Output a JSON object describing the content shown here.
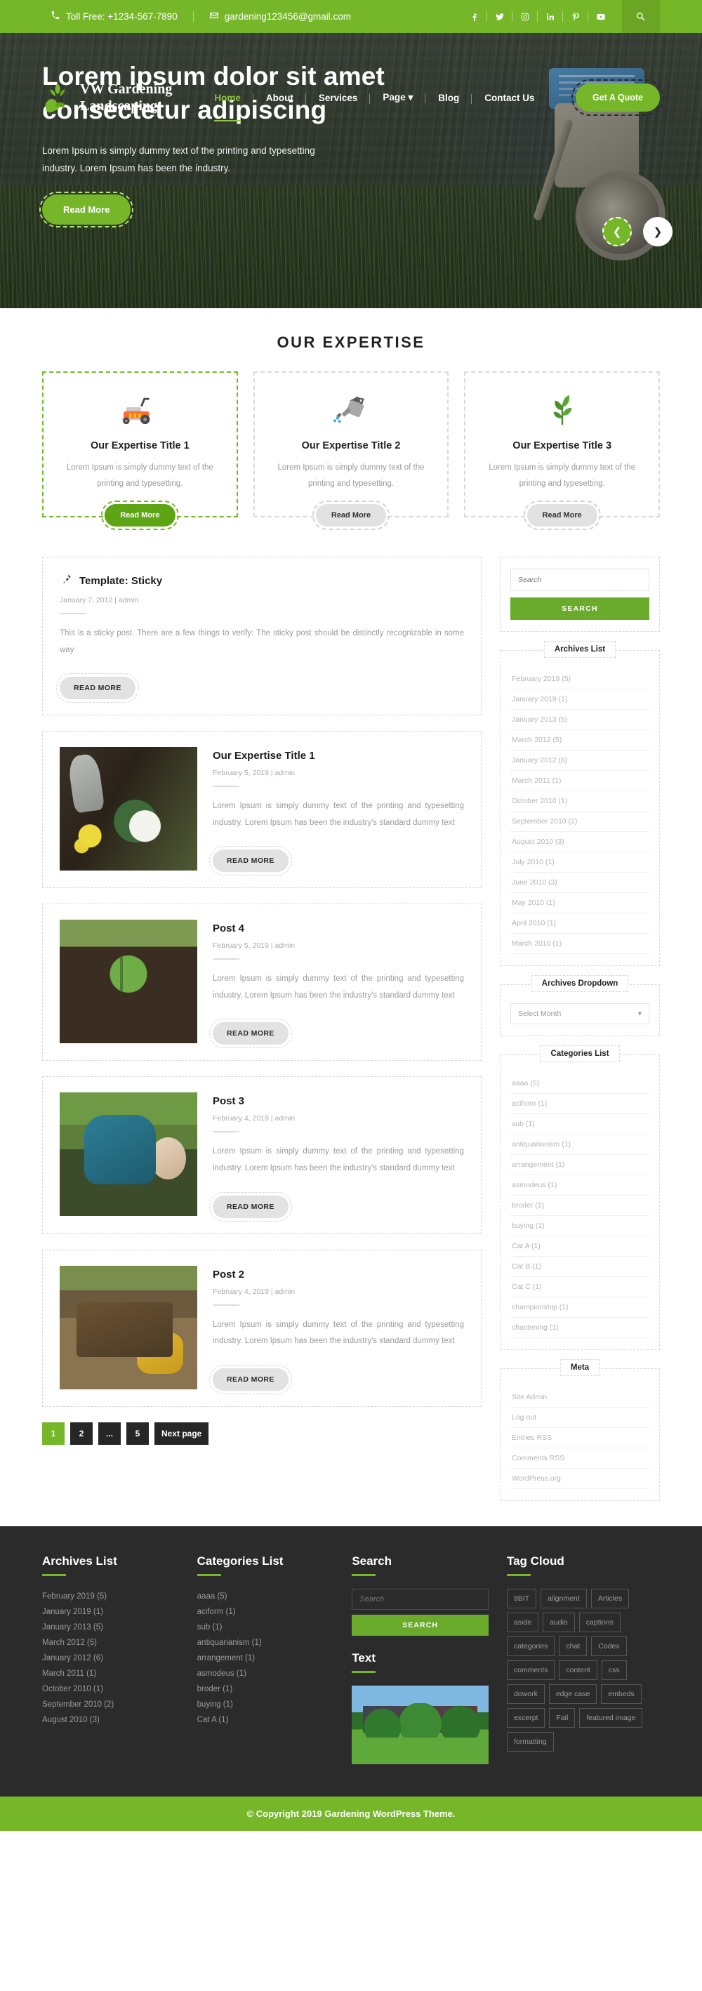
{
  "topbar": {
    "phone_icon": "phone-icon",
    "phone": "Toll Free: +1234-567-7890",
    "email_icon": "envelope-icon",
    "email": "gardening123456@gmail.com",
    "socials": [
      {
        "name": "facebook-icon",
        "label": "Facebook"
      },
      {
        "name": "twitter-icon",
        "label": "Twitter"
      },
      {
        "name": "instagram-icon",
        "label": "Instagram"
      },
      {
        "name": "linkedin-icon",
        "label": "LinkedIn"
      },
      {
        "name": "pinterest-icon",
        "label": "Pinterest"
      },
      {
        "name": "youtube-icon",
        "label": "YouTube"
      }
    ],
    "search_icon": "search-icon"
  },
  "header": {
    "logo_line1": "VW Gardening",
    "logo_line2": "Landscaping",
    "nav": [
      {
        "label": "Home",
        "active": true
      },
      {
        "label": "About",
        "active": false
      },
      {
        "label": "Services",
        "active": false
      },
      {
        "label": "Page",
        "active": false,
        "caret": true
      },
      {
        "label": "Blog",
        "active": false
      },
      {
        "label": "Contact Us",
        "active": false
      }
    ],
    "quote_button": "Get A Quote"
  },
  "hero": {
    "heading": "Lorem ipsum dolor sit amet consectetur adipiscing",
    "paragraph": "Lorem Ipsum is simply dummy text of the printing and typesetting industry. Lorem Ipsum has been the industry.",
    "button": "Read More",
    "prev_icon": "chevron-left-icon",
    "next_icon": "chevron-right-icon",
    "accent_color": "#76b729"
  },
  "expertise": {
    "section_title": "OUR EXPERTISE",
    "cards": [
      {
        "icon": "lawnmower-icon",
        "title": "Our Expertise Title 1",
        "text": "Lorem Ipsum is simply dummy text of the printing and typesetting.",
        "button": "Read More",
        "active": true
      },
      {
        "icon": "watering-can-icon",
        "title": "Our Expertise Title 2",
        "text": "Lorem Ipsum is simply dummy text of the printing and typesetting.",
        "button": "Read More",
        "active": false
      },
      {
        "icon": "plant-leaf-icon",
        "title": "Our Expertise Title 3",
        "text": "Lorem Ipsum is simply dummy text of the printing and typesetting.",
        "button": "Read More",
        "active": false
      }
    ]
  },
  "posts": [
    {
      "sticky": true,
      "pin_icon": "pushpin-icon",
      "title": "Template: Sticky",
      "meta": "January 7, 2012 |  admin",
      "excerpt": "This is a sticky post. There are a few things to verify: The sticky post should be distinctly recognizable in some way",
      "button": "READ MORE"
    },
    {
      "sticky": false,
      "thumb": "gardening-tools-photo",
      "title": "Our Expertise Title 1",
      "meta": "February 5, 2019 |  admin",
      "excerpt": "Lorem Ipsum is simply dummy text of the printing and typesetting industry. Lorem Ipsum has been the industry's standard dummy text",
      "button": "READ MORE"
    },
    {
      "sticky": false,
      "thumb": "seedling-soil-photo",
      "title": "Post 4",
      "meta": "February 5, 2019 |  admin",
      "excerpt": "Lorem Ipsum is simply dummy text of the printing and typesetting industry. Lorem Ipsum has been the industry's standard dummy text",
      "button": "READ MORE"
    },
    {
      "sticky": false,
      "thumb": "gardener-working-photo",
      "title": "Post 3",
      "meta": "February 4, 2019 |  admin",
      "excerpt": "Lorem Ipsum is simply dummy text of the printing and typesetting industry. Lorem Ipsum has been the industry's standard dummy text",
      "button": "READ MORE"
    },
    {
      "sticky": false,
      "thumb": "garden-gloves-tools-photo",
      "title": "Post 2",
      "meta": "February 4, 2019 |  admin",
      "excerpt": "Lorem Ipsum is simply dummy text of the printing and typesetting industry. Lorem Ipsum has been the industry's standard dummy text",
      "button": "READ MORE"
    }
  ],
  "pagination": [
    {
      "label": "1",
      "current": true
    },
    {
      "label": "2",
      "current": false
    },
    {
      "label": "...",
      "current": false
    },
    {
      "label": "5",
      "current": false
    },
    {
      "label": "Next page",
      "current": false
    }
  ],
  "sidebar": {
    "search": {
      "placeholder": "Search",
      "value": "",
      "button": "SEARCH"
    },
    "archives_list": {
      "title": "Archives List",
      "items": [
        "February 2019 (5)",
        "January 2019 (1)",
        "January 2013 (5)",
        "March 2012 (5)",
        "January 2012 (6)",
        "March 2011 (1)",
        "October 2010 (1)",
        "September 2010 (2)",
        "August 2010 (3)",
        "July 2010 (1)",
        "June 2010 (3)",
        "May 2010 (1)",
        "April 2010 (1)",
        "March 2010 (1)"
      ]
    },
    "archives_dropdown": {
      "title": "Archives Dropdown",
      "selected": "Select Month",
      "caret_icon": "chevron-down-icon"
    },
    "categories_list": {
      "title": "Categories List",
      "items": [
        "aaaa (5)",
        "aciform (1)",
        "sub (1)",
        "antiquarianism (1)",
        "arrangement (1)",
        "asmodeus (1)",
        "broder (1)",
        "buying (1)",
        "Cat A (1)",
        "Cat B (1)",
        "Cat C (1)",
        "championship (1)",
        "chastening (1)"
      ]
    },
    "meta": {
      "title": "Meta",
      "items": [
        "Site Admin",
        "Log out",
        "Entries RSS",
        "Comments RSS",
        "WordPress.org"
      ]
    }
  },
  "footer": {
    "archives": {
      "title": "Archives List",
      "items": [
        "February 2019 (5)",
        "January 2019 (1)",
        "January 2013 (5)",
        "March 2012 (5)",
        "January 2012 (6)",
        "March 2011 (1)",
        "October 2010 (1)",
        "September 2010 (2)",
        "August 2010 (3)"
      ]
    },
    "categories": {
      "title": "Categories List",
      "items": [
        "aaaa (5)",
        "aciform (1)",
        "sub (1)",
        "antiquarianism (1)",
        "arrangement (1)",
        "asmodeus (1)",
        "broder (1)",
        "buying (1)",
        "Cat A (1)"
      ]
    },
    "search": {
      "title": "Search",
      "placeholder": "Search",
      "value": "",
      "button": "SEARCH"
    },
    "text_widget": {
      "title": "Text",
      "image": "landscaped-garden-house-photo"
    },
    "tag_cloud": {
      "title": "Tag Cloud",
      "tags": [
        "8BIT",
        "alignment",
        "Articles",
        "aside",
        "audio",
        "captions",
        "categories",
        "chat",
        "Codex",
        "comments",
        "content",
        "css",
        "dowork",
        "edge case",
        "embeds",
        "excerpt",
        "Fail",
        "featured image",
        "formatting"
      ]
    },
    "copyright": "© Copyright 2019 Gardening WordPress Theme."
  }
}
